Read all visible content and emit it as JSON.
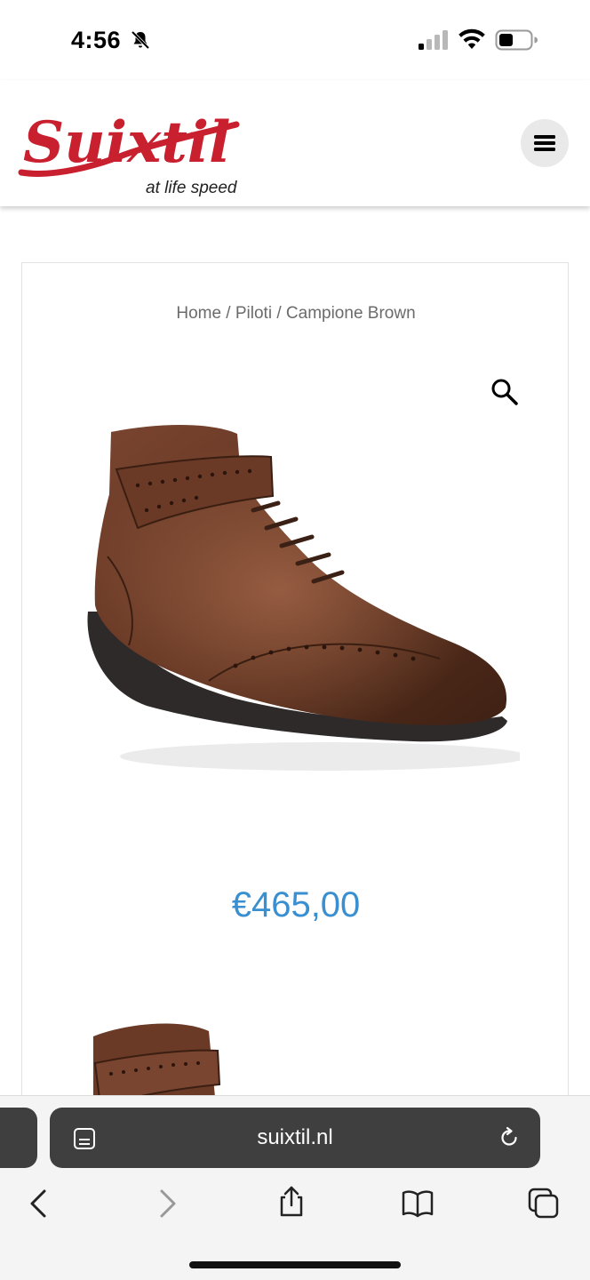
{
  "status_bar": {
    "time": "4:56",
    "icons": [
      "bell-slash-icon",
      "cellular-signal-icon",
      "wifi-icon",
      "battery-icon"
    ]
  },
  "header": {
    "logo_text": "Suixtil",
    "logo_tagline": "at life speed",
    "menu_icon": "hamburger-icon",
    "brand_color": "#c8202f"
  },
  "product": {
    "breadcrumb": {
      "home": "Home",
      "category": "Piloti",
      "current": "Campione Brown",
      "separator": " / "
    },
    "zoom_icon": "magnifier-icon",
    "image": "brown-leather-racing-boot",
    "price": "€465,00",
    "price_color": "#3a8fd0"
  },
  "browser": {
    "url": "suixtil.nl",
    "reader_icon": "reader-mode-icon",
    "reload_icon": "reload-icon",
    "toolbar_icons": [
      "back-icon",
      "forward-icon",
      "share-icon",
      "bookmarks-icon",
      "tabs-icon"
    ]
  }
}
